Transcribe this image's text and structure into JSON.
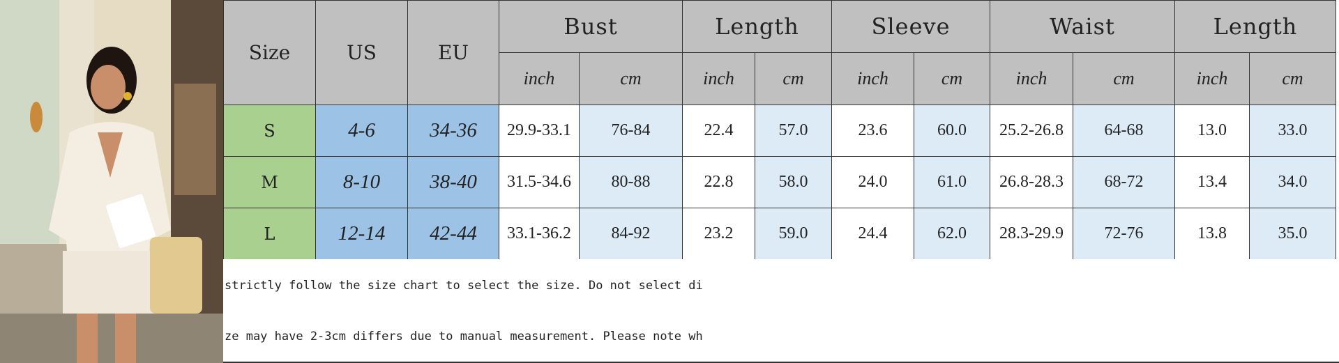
{
  "table": {
    "headers": {
      "size": "Size",
      "us": "US",
      "eu": "EU",
      "groups": [
        "Bust",
        "Length",
        "Sleeve",
        "Waist",
        "Length"
      ],
      "units": [
        "inch",
        "cm"
      ]
    },
    "rows": [
      {
        "size": "S",
        "us": "4-6",
        "eu": "34-36",
        "values": [
          "29.9-33.1",
          "76-84",
          "22.4",
          "57.0",
          "23.6",
          "60.0",
          "25.2-26.8",
          "64-68",
          "13.0",
          "33.0"
        ]
      },
      {
        "size": "M",
        "us": "8-10",
        "eu": "38-40",
        "values": [
          "31.5-34.6",
          "80-88",
          "22.8",
          "58.0",
          "24.0",
          "61.0",
          "26.8-28.3",
          "68-72",
          "13.4",
          "34.0"
        ]
      },
      {
        "size": "L",
        "us": "12-14",
        "eu": "42-44",
        "values": [
          "33.1-36.2",
          "84-92",
          "23.2",
          "59.0",
          "24.4",
          "62.0",
          "28.3-29.9",
          "72-76",
          "13.8",
          "35.0"
        ]
      }
    ]
  },
  "notes": [
    "strictly follow the size chart to select the size. Do not select di",
    "ze may have 2-3cm differs due to manual measurement. Please note wh"
  ],
  "colors": {
    "header_gray": "#c0c0c0",
    "size_green": "#a9d08e",
    "us_eu_blue": "#9cc2e5",
    "cm_light_blue": "#ddebf7"
  }
}
